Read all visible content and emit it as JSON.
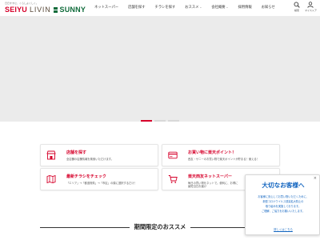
{
  "header": {
    "tagline": "日日すすむ、くらしよくしく。",
    "logo": {
      "seiyu": "SEIYU",
      "livin": "LIVIN",
      "sunny": "SUNNY"
    },
    "nav": [
      {
        "label": "ネットスーパー",
        "has_dropdown": false
      },
      {
        "label": "店舗を探す",
        "has_dropdown": false
      },
      {
        "label": "チラシを探す",
        "has_dropdown": false
      },
      {
        "label": "おススメ",
        "has_dropdown": true
      },
      {
        "label": "会社概要",
        "has_dropdown": true
      },
      {
        "label": "採用情報",
        "has_dropdown": false
      },
      {
        "label": "お知らせ",
        "has_dropdown": false
      }
    ],
    "search_label": "検索",
    "mypage_label": "マイストア"
  },
  "carousel": {
    "slide_count": 3,
    "active_index": 0
  },
  "cards": [
    {
      "title": "店舗を探す",
      "desc": "全店舗の店舗情報を検索いただけます。",
      "desc2": "",
      "icon": "store-icon"
    },
    {
      "title": "お買い物に楽天ポイント！",
      "desc": "西友・サニーのお買い物で楽天ポイントが貯まる！使える！",
      "desc2": "",
      "icon": "credit-card-icon"
    },
    {
      "title": "最新チラシをチェック",
      "desc": "「エリア」→「都道府県」→「市区」の順に選択するだけ！",
      "desc2": "",
      "icon": "map-icon"
    },
    {
      "title": "楽天西友ネットスーパー",
      "desc": "毎日の買い物をネットで。便利に、お得に",
      "desc2": "最短当日お届け",
      "icon": "cart-icon"
    }
  ],
  "section": {
    "title": "期間限定のおススメ"
  },
  "popup": {
    "title": "大切なお客様へ",
    "close": "×",
    "lines": [
      "お客様に安心してお買い物いただくために、",
      "新型コロナウイルス感染拡大防止の",
      "取り組みを実施しております。",
      "ご理解、ご協力をお願いいたします。"
    ],
    "more": "詳しくはこちら"
  },
  "colors": {
    "brand_red": "#d6002a",
    "brand_green": "#0f6b3a",
    "popup_blue": "#1466c0",
    "hero_bg": "#ebebeb"
  }
}
